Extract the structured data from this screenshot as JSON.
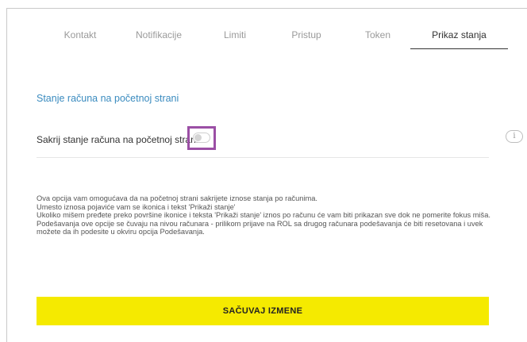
{
  "tabs": [
    {
      "label": "Kontakt",
      "active": false
    },
    {
      "label": "Notifikacije",
      "active": false
    },
    {
      "label": "Limiti",
      "active": false
    },
    {
      "label": "Pristup",
      "active": false
    },
    {
      "label": "Token",
      "active": false
    },
    {
      "label": "Prikaz stanja",
      "active": true
    }
  ],
  "section": {
    "title": "Stanje računa na početnoj strani",
    "toggle_label": "Sakrij stanje računa na početnoj strani",
    "toggle_on": false,
    "info_icon_text": "i"
  },
  "description": [
    "Ova opcija vam omogućava da na početnoj strani sakrijete iznose stanja po računima.",
    "Umesto iznosa pojaviće vam se ikonica i tekst 'Prikaži stanje'",
    "Ukoliko mišem pređete preko površine ikonice i teksta 'Prikaži stanje' iznos po računu će vam biti prikazan sve dok ne pomerite fokus miša.",
    "Podešavanja ove opcije se čuvaju na nivou računara - prilikom prijave na ROL sa drugog računara podešavanja će biti resetovana i uvek možete da ih podesite u okviru opcija Podešavanja."
  ],
  "save_button": "SAČUVAJ IZMENE",
  "colors": {
    "accent_blue": "#3a8bbf",
    "save_yellow": "#f5ea00",
    "highlight_purple": "#9b4fa5"
  }
}
